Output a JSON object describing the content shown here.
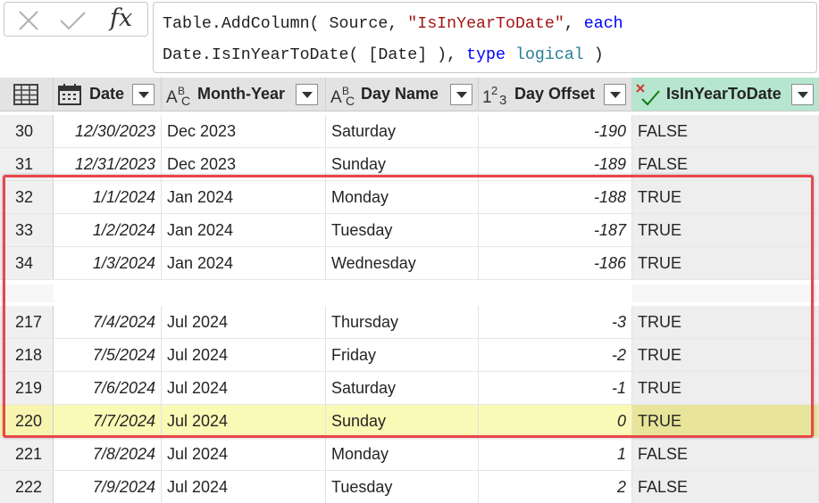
{
  "formula": {
    "line1_a": "Table.AddColumn( Source, ",
    "line1_str": "\"IsInYearToDate\"",
    "line1_sep": ", ",
    "line1_kw": "each",
    "line2_a": "Date.IsInYearToDate( [Date] ), ",
    "line2_kw": "type",
    "line2_sep": " ",
    "line2_type": "logical",
    "line2_end": " )",
    "fx_label": "fx"
  },
  "columns": [
    {
      "name": "Date",
      "type_icon": "calendar-icon"
    },
    {
      "name": "Month-Year",
      "type_icon": "text-type-icon"
    },
    {
      "name": "Day Name",
      "type_icon": "text-type-icon"
    },
    {
      "name": "Day Offset",
      "type_icon": "number-type-icon"
    },
    {
      "name": "IsInYearToDate",
      "type_icon": "logical-type-icon"
    }
  ],
  "rows": [
    {
      "n": "30",
      "date": "12/30/2023",
      "my": "Dec 2023",
      "day": "Saturday",
      "off": "-190",
      "ytd": "FALSE"
    },
    {
      "n": "31",
      "date": "12/31/2023",
      "my": "Dec 2023",
      "day": "Sunday",
      "off": "-189",
      "ytd": "FALSE"
    },
    {
      "n": "32",
      "date": "1/1/2024",
      "my": "Jan 2024",
      "day": "Monday",
      "off": "-188",
      "ytd": "TRUE"
    },
    {
      "n": "33",
      "date": "1/2/2024",
      "my": "Jan 2024",
      "day": "Tuesday",
      "off": "-187",
      "ytd": "TRUE"
    },
    {
      "n": "34",
      "date": "1/3/2024",
      "my": "Jan 2024",
      "day": "Wednesday",
      "off": "-186",
      "ytd": "TRUE"
    },
    {
      "n": "217",
      "date": "7/4/2024",
      "my": "Jul 2024",
      "day": "Thursday",
      "off": "-3",
      "ytd": "TRUE"
    },
    {
      "n": "218",
      "date": "7/5/2024",
      "my": "Jul 2024",
      "day": "Friday",
      "off": "-2",
      "ytd": "TRUE"
    },
    {
      "n": "219",
      "date": "7/6/2024",
      "my": "Jul 2024",
      "day": "Saturday",
      "off": "-1",
      "ytd": "TRUE"
    },
    {
      "n": "220",
      "date": "7/7/2024",
      "my": "Jul 2024",
      "day": "Sunday",
      "off": "0",
      "ytd": "TRUE"
    },
    {
      "n": "221",
      "date": "7/8/2024",
      "my": "Jul 2024",
      "day": "Monday",
      "off": "1",
      "ytd": "FALSE"
    },
    {
      "n": "222",
      "date": "7/9/2024",
      "my": "Jul 2024",
      "day": "Tuesday",
      "off": "2",
      "ytd": "FALSE"
    }
  ],
  "highlighted_row": "220",
  "colors": {
    "selected_header": "#b7e6d0",
    "highlight_row": "#fbf9b6",
    "annotation_box": "#e8474c"
  }
}
